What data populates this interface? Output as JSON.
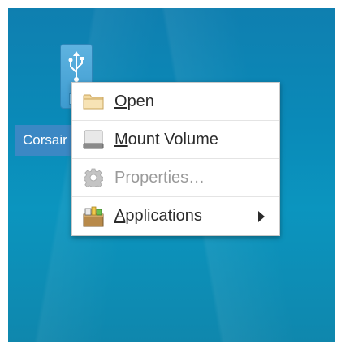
{
  "desktop": {
    "icon": {
      "label": "Corsair",
      "icon_name": "usb-drive-icon"
    }
  },
  "context_menu": {
    "items": [
      {
        "id": "open",
        "mnemonic": "O",
        "rest": "pen",
        "icon": "folder-icon",
        "enabled": true,
        "has_submenu": false
      },
      {
        "id": "mount",
        "mnemonic": "M",
        "rest": "ount Volume",
        "icon": "drive-icon",
        "enabled": true,
        "has_submenu": false
      },
      {
        "id": "properties",
        "mnemonic": "",
        "rest": "Properties…",
        "icon": "gear-icon",
        "enabled": false,
        "has_submenu": false
      },
      {
        "id": "applications",
        "mnemonic": "A",
        "rest": "pplications",
        "icon": "applications-icon",
        "enabled": true,
        "has_submenu": true
      }
    ]
  },
  "colors": {
    "desktop_bg": "#0a8ab8",
    "selection": "#3b88c4",
    "disabled_text": "#9a9a9a"
  }
}
